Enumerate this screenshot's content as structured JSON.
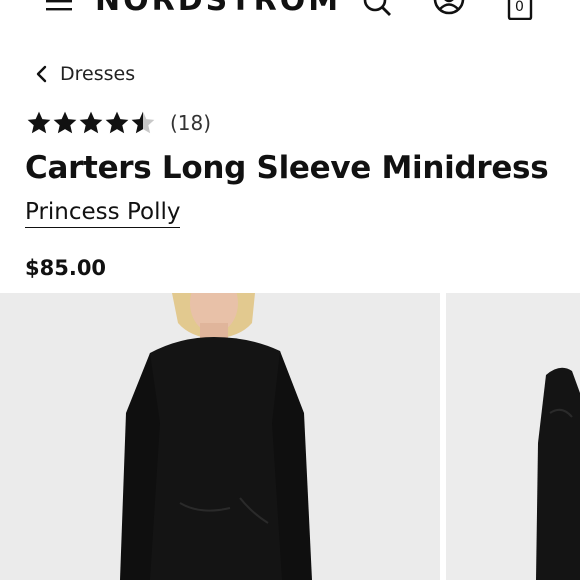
{
  "header": {
    "logo": "NORDSTROM",
    "bag_count": "0"
  },
  "breadcrumb": {
    "label": "Dresses"
  },
  "rating": {
    "stars": 4.5,
    "count_label": "(18)"
  },
  "product": {
    "title": "Carters Long Sleeve Minidress",
    "brand": "Princess Polly",
    "price": "$85.00"
  },
  "icons": {
    "menu": "menu-icon",
    "search": "search-icon",
    "account": "account-icon",
    "bag": "shopping-bag-icon",
    "back": "chevron-left-icon",
    "star": "star-icon"
  },
  "colors": {
    "text": "#111111",
    "image_bg": "#ebebeb",
    "dress": "#141414",
    "star_empty": "#c8c8c8"
  }
}
